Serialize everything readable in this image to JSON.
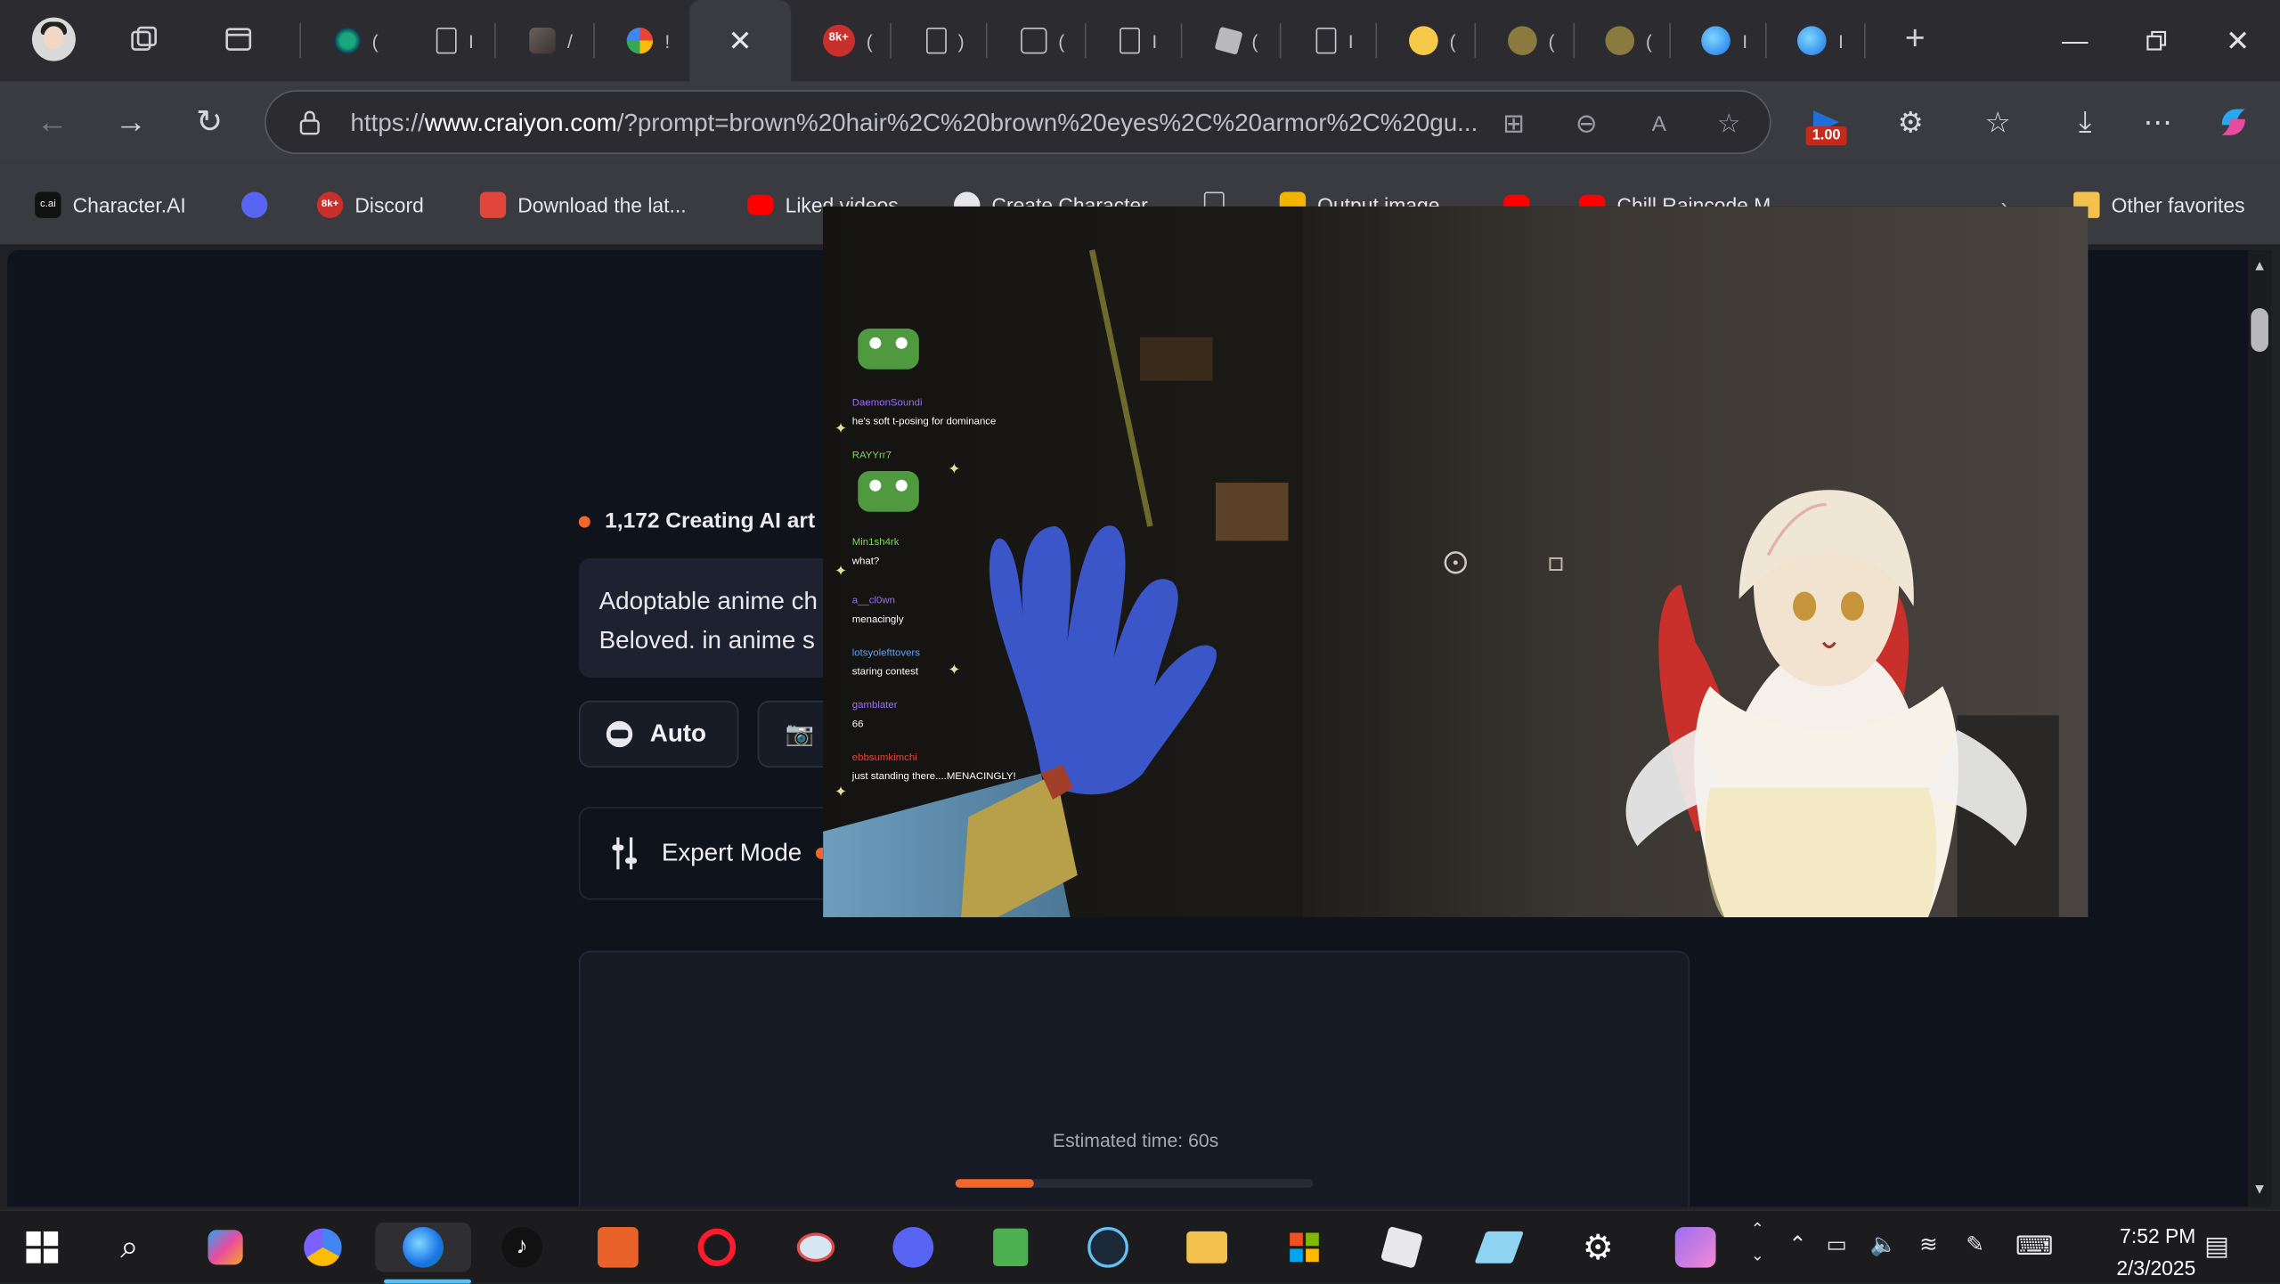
{
  "browser": {
    "address_url_prefix": "https://",
    "address_url_domain": "www.craiyon.com",
    "address_url_rest": "/?prompt=brown%20hair%2C%20brown%20eyes%2C%20armor%2C%20gu...",
    "extension_badge": "1.00",
    "tabs": [
      {
        "favicon": "globe-icon",
        "label": "("
      },
      {
        "favicon": "page-icon",
        "label": "I"
      },
      {
        "favicon": "image-icon",
        "label": "/"
      },
      {
        "favicon": "pinwheel-icon",
        "label": "!"
      },
      {
        "favicon": "close-icon",
        "label": ""
      },
      {
        "favicon": "8k-icon",
        "label": "("
      },
      {
        "favicon": "page-icon",
        "label": ")"
      },
      {
        "favicon": "picture-icon",
        "label": "("
      },
      {
        "favicon": "page-icon",
        "label": "I"
      },
      {
        "favicon": "roblox-icon",
        "label": "("
      },
      {
        "favicon": "page-icon",
        "label": "I"
      },
      {
        "favicon": "hugging-face-icon",
        "label": "("
      },
      {
        "favicon": "hugging-face-icon",
        "label": "("
      },
      {
        "favicon": "hugging-face-icon",
        "label": "("
      },
      {
        "favicon": "edge-icon",
        "label": "I"
      },
      {
        "favicon": "edge-icon",
        "label": "I"
      }
    ],
    "favorites": [
      {
        "icon": "character-ai-icon",
        "label": "Character.AI"
      },
      {
        "icon": "discord-icon",
        "label": ""
      },
      {
        "icon": "8k-icon",
        "label": "Discord"
      },
      {
        "icon": "store-icon",
        "label": "Download the lat..."
      },
      {
        "icon": "youtube-icon",
        "label": "Liked videos"
      },
      {
        "icon": "openai-icon",
        "label": "Create Character"
      },
      {
        "icon": "page-icon",
        "label": ""
      },
      {
        "icon": "hugging-face-icon",
        "label": "Output image"
      },
      {
        "icon": "youtube-icon",
        "label": ""
      },
      {
        "icon": "youtube-icon",
        "label": "Chill Raincode M"
      }
    ],
    "other_favorites": "Other favorites"
  },
  "craiyon": {
    "counter": "1,172 Creating AI art",
    "prompt_line1": "Adoptable anime ch",
    "prompt_line2": "Beloved. in anime s",
    "auto_label": "Auto",
    "expert_label": "Expert Mode",
    "estimated_time": "Estimated time: 60s",
    "progress": 0.22
  },
  "video_chat": [
    {
      "user": "DaemonSoundi",
      "msg": "he's soft t-posing for dominance"
    },
    {
      "user": "RAYYrr7",
      "msg": ""
    },
    {
      "user": "Min1sh4rk",
      "msg": "what?"
    },
    {
      "user": "a__cl0wn",
      "msg": "menacingly"
    },
    {
      "user": "lotsyolefttovers",
      "msg": "staring contest"
    },
    {
      "user": "gamblater",
      "msg": "66"
    },
    {
      "user": "ebbsumkimchi",
      "msg": "just standing there....MENACINGLY!"
    }
  ],
  "taskbar": {
    "time": "7:52 PM",
    "date": "2/3/2025"
  },
  "colors": {
    "accent": "#f2662a",
    "page_bg": "#0f131c",
    "chrome": "#3a3b40"
  }
}
